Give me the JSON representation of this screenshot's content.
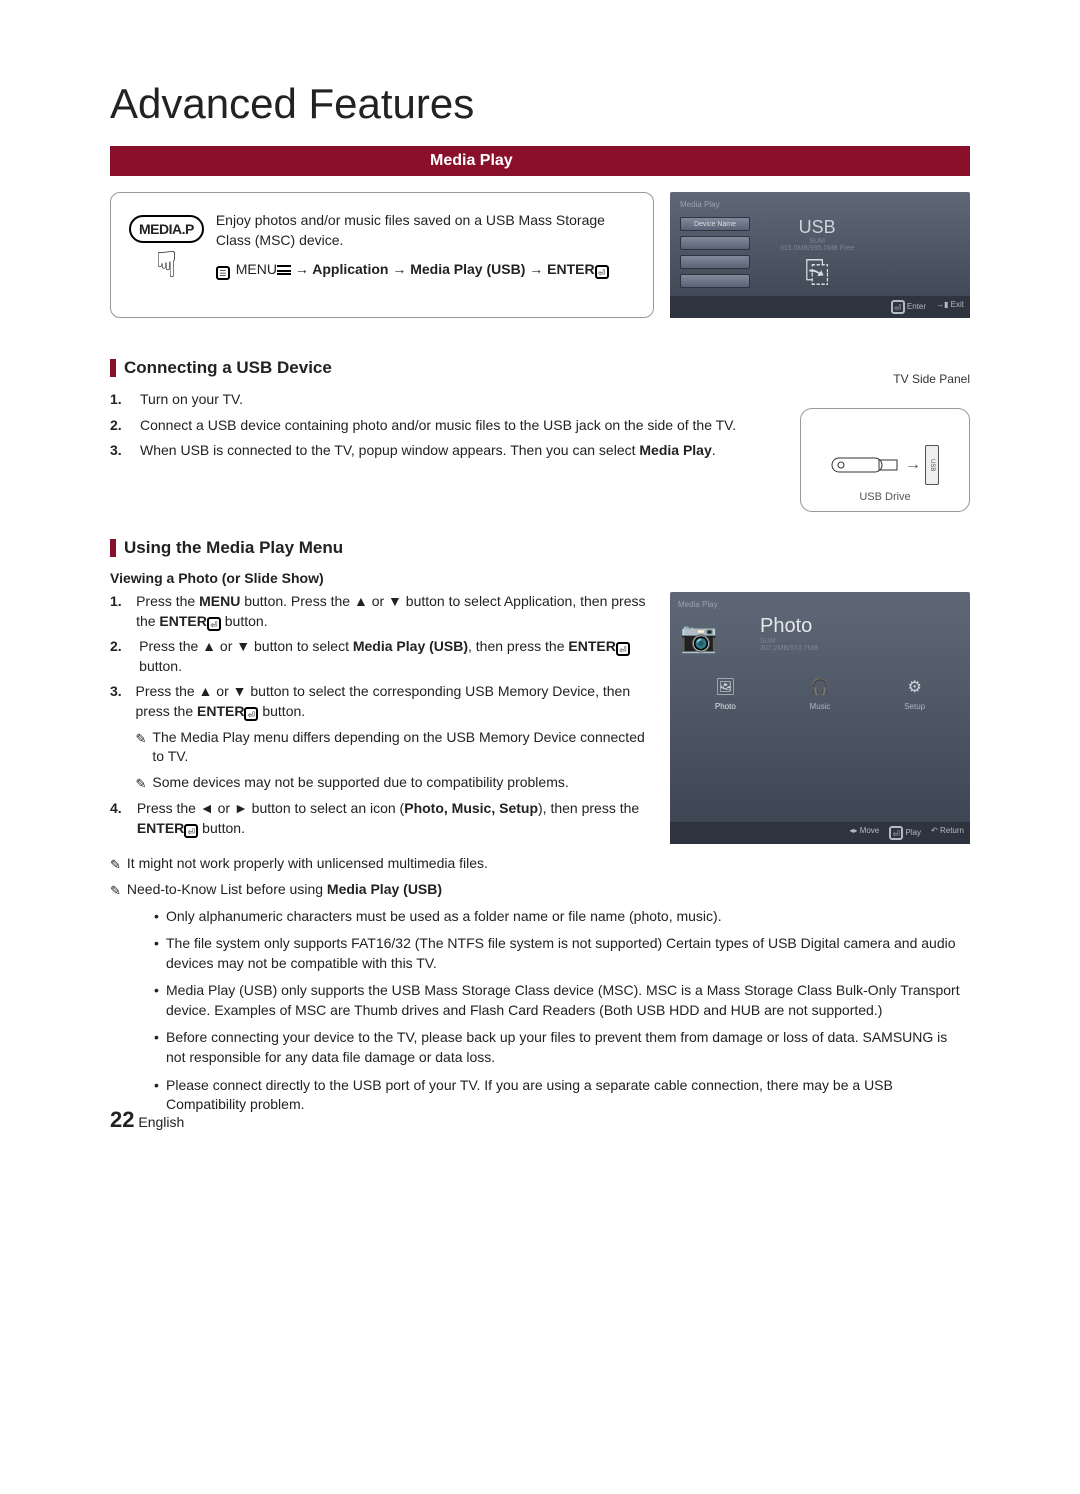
{
  "page": {
    "title": "Advanced Features",
    "section_header": "Media Play",
    "page_number": "22",
    "language": "English"
  },
  "intro": {
    "button_label": "MEDIA.P",
    "desc": "Enjoy photos and/or music files saved on a USB Mass Storage Class (MSC) device.",
    "nav_prefix": "MENU",
    "nav_path": " → Application → Media Play (USB) → ENTER"
  },
  "tv1": {
    "tag": "Media Play",
    "device_label": "Device Name",
    "usb_title": "USB",
    "usb_sub1": "SUM",
    "usb_sub2": "315.0MB/995.0MB Free",
    "enter": "Enter",
    "exit": "Exit"
  },
  "sectionA": {
    "heading": "Connecting a USB Device",
    "panel_label": "TV Side Panel",
    "usb_drive_label": "USB Drive",
    "usb_port_label": "USB",
    "steps": [
      "Turn on your TV.",
      "Connect a USB device containing photo and/or music files to the USB jack on the side of the TV.",
      "When USB is connected to the TV, popup window appears. Then you can select Media Play."
    ]
  },
  "sectionB": {
    "heading": "Using the Media Play Menu",
    "subheading": "Viewing a Photo (or Slide Show)",
    "step1_a": "Press the MENU button. Press the ▲ or ▼ button to select Application, then press the ENTER",
    "step1_b": " button.",
    "step2_a": "Press the ▲ or ▼ button to select Media Play (USB), then press the ENTER",
    "step2_b": " button.",
    "step3_a": "Press the ▲ or ▼ button to select the corresponding USB Memory Device, then press the ENTER",
    "step3_b": " button.",
    "step3_note1": "The Media Play menu differs depending on the USB Memory Device connected to TV.",
    "step3_note2": "Some devices may not be supported due to compatibility problems.",
    "step4_a": "Press the ◄ or ► button to select an icon (Photo, Music, Setup), then press the ENTER",
    "step4_b": " button."
  },
  "tv2": {
    "tag": "Media Play",
    "title": "Photo",
    "sub1": "SUM",
    "sub2": "307.2MB/973.7MB",
    "icon1": "Photo",
    "icon2": "Music",
    "icon3": "Setup",
    "bar_move": "Move",
    "bar_play": "Play",
    "bar_return": "Return"
  },
  "notes": {
    "n1": "It might not work properly with unlicensed multimedia files.",
    "n2_prefix": "Need-to-Know List before using ",
    "n2_bold": "Media Play (USB)",
    "bullets": [
      "Only alphanumeric characters must be used as a folder name or file name (photo, music).",
      "The file system only supports FAT16/32 (The NTFS file system is not supported) Certain types of USB Digital camera and audio devices may not be compatible with this TV.",
      "Media Play (USB) only supports the USB Mass Storage Class device (MSC). MSC is a Mass Storage Class Bulk-Only Transport device. Examples of MSC are Thumb drives and Flash Card Readers (Both USB HDD and HUB are not supported.)",
      "Before connecting your device to the TV, please back up your files to prevent them from damage or loss of data. SAMSUNG is not responsible for any data file damage or data loss.",
      "Please connect directly to the USB port of your TV. If you are using a separate cable connection, there may be a USB Compatibility problem."
    ]
  }
}
